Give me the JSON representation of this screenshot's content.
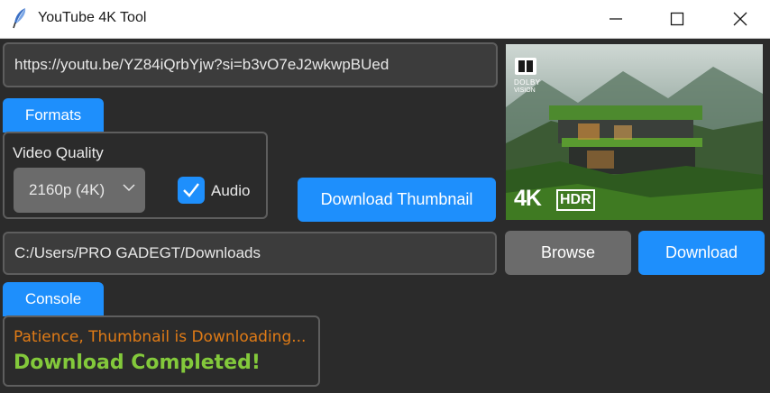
{
  "window": {
    "title": "YouTube 4K Tool",
    "app_icon": "feather-icon",
    "controls": [
      "minimize-icon",
      "maximize-icon",
      "close-icon"
    ]
  },
  "url_input": {
    "value": "https://youtu.be/YZ84iQrbYjw?si=b3vO7eJ2wkwpBUed"
  },
  "formats": {
    "tab_label": "Formats",
    "video_quality_label": "Video Quality",
    "quality_selected": "2160p (4K)",
    "audio_label": "Audio",
    "audio_checked": true
  },
  "thumbnail": {
    "dolby_line1": "DOLBY",
    "dolby_line2": "VISION",
    "badge_4k": "4K",
    "badge_hdr": "HDR"
  },
  "download_thumbnail_button": "Download Thumbnail",
  "path_input": {
    "value": "C:/Users/PRO GADEGT/Downloads"
  },
  "browse_button": "Browse",
  "download_button": "Download",
  "console": {
    "tab_label": "Console",
    "line1": "Patience, Thumbnail is Downloading...",
    "line2": "Download Completed!"
  },
  "colors": {
    "accent": "#1e8ffc",
    "background": "#2b2b2b",
    "console_warning": "#e07b16",
    "console_success": "#83c93b"
  }
}
